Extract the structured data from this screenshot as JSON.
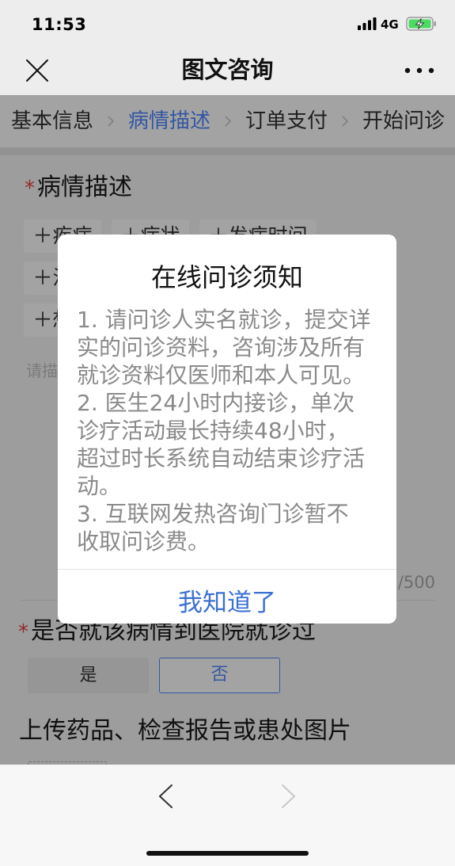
{
  "status_bar": {
    "time": "11:53",
    "network": "4G",
    "icons": {
      "signal": "signal-icon",
      "battery": "battery-charging-icon"
    }
  },
  "nav": {
    "title": "图文咨询",
    "icons": {
      "close": "close-icon",
      "more": "more-icon"
    }
  },
  "steps": [
    {
      "label": "基本信息",
      "active": false
    },
    {
      "label": "病情描述",
      "active": true
    },
    {
      "label": "订单支付",
      "active": false
    },
    {
      "label": "开始问诊",
      "active": false
    }
  ],
  "condition": {
    "required_mark": "*",
    "title": "病情描述",
    "tags": [
      "＋疾病",
      "＋症状",
      "＋发病时间",
      "＋治",
      "＋想"
    ],
    "placeholder": "请描",
    "counter": "/500"
  },
  "visited": {
    "required_mark": "*",
    "question": "是否就该病情到医院就诊过",
    "options": [
      {
        "label": "是",
        "selected": false
      },
      {
        "label": "否",
        "selected": true
      }
    ]
  },
  "upload": {
    "title": "上传药品、检查报告或患处图片"
  },
  "notice": {
    "title": "在线问诊须知",
    "paragraphs": [
      [
        "1. 请问诊人实名就诊，提交详",
        "实的问诊资料，咨询涉及所有",
        "就诊资料仅医师和本人可见。"
      ],
      [
        "2. 医生24小时内接诊，单次",
        "诊疗活动最长持续48小时，",
        "超过时长系统自动结束诊疗活",
        "动。"
      ],
      [
        "3. 互联网发热咨询门诊暂不",
        "收取问诊费。"
      ]
    ],
    "confirm_label": "我知道了"
  },
  "browser_toolbar": {
    "icons": {
      "back": "chevron-left-icon",
      "forward": "chevron-right-icon"
    },
    "back_enabled": true,
    "forward_enabled": false
  },
  "colors": {
    "accent": "#5089ff",
    "confirm": "#3b70d3",
    "required": "#e64340",
    "battery": "#4cd964"
  }
}
